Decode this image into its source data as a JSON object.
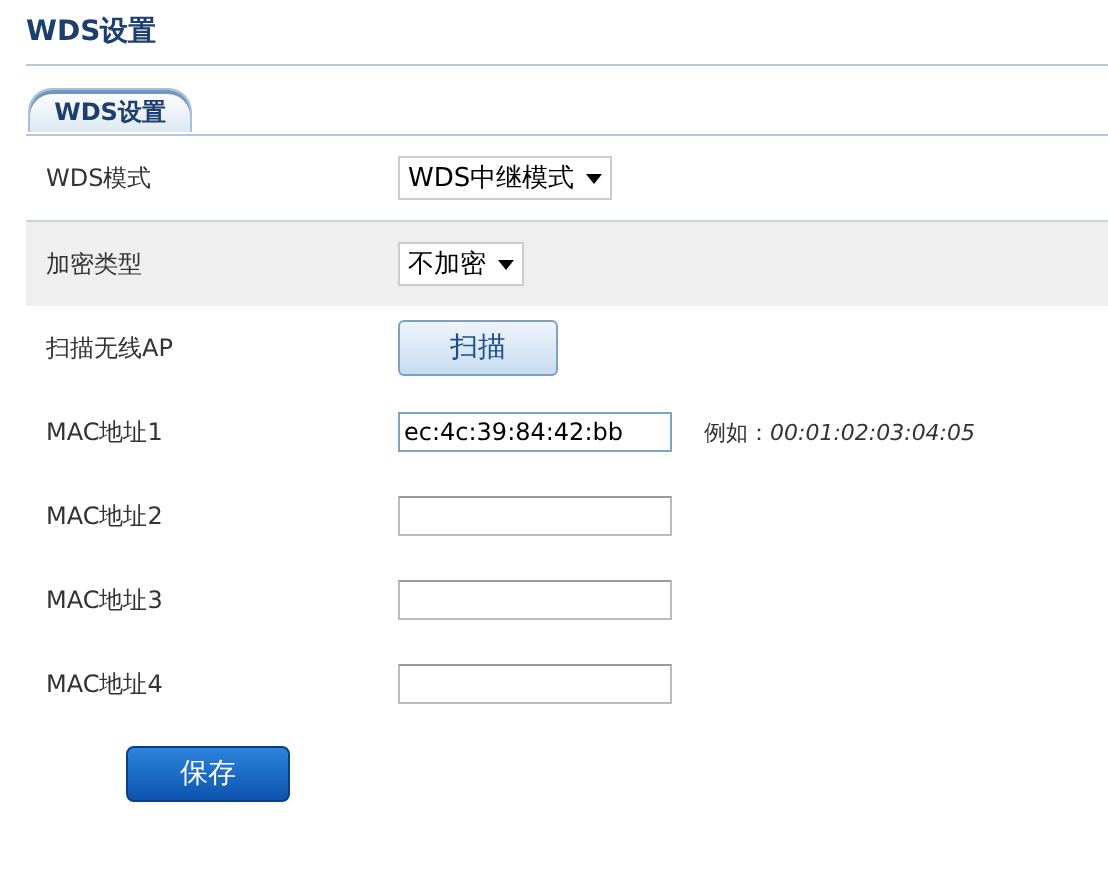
{
  "page_title": "WDS设置",
  "tabs": [
    {
      "label": "WDS设置",
      "selected": true
    }
  ],
  "rows": [
    {
      "kind": "select",
      "label": "WDS模式",
      "value": "WDS中继模式",
      "highlighted": false
    },
    {
      "kind": "select",
      "label": "加密类型",
      "value": "不加密",
      "highlighted": true
    },
    {
      "kind": "button",
      "label": "扫描无线AP",
      "button": "扫描",
      "highlighted": false
    },
    {
      "kind": "input",
      "label": "MAC地址1",
      "value": "ec:4c:39:84:42:bb",
      "hint": "例如：*00:01:02:03:04:05*",
      "highlighted": false
    },
    {
      "kind": "input",
      "label": "MAC地址2",
      "highlighted": false
    },
    {
      "kind": "input",
      "label": "MAC地址3",
      "highlighted": false
    },
    {
      "kind": "input",
      "label": "MAC地址4",
      "highlighted": false
    }
  ],
  "save_button": "保存"
}
